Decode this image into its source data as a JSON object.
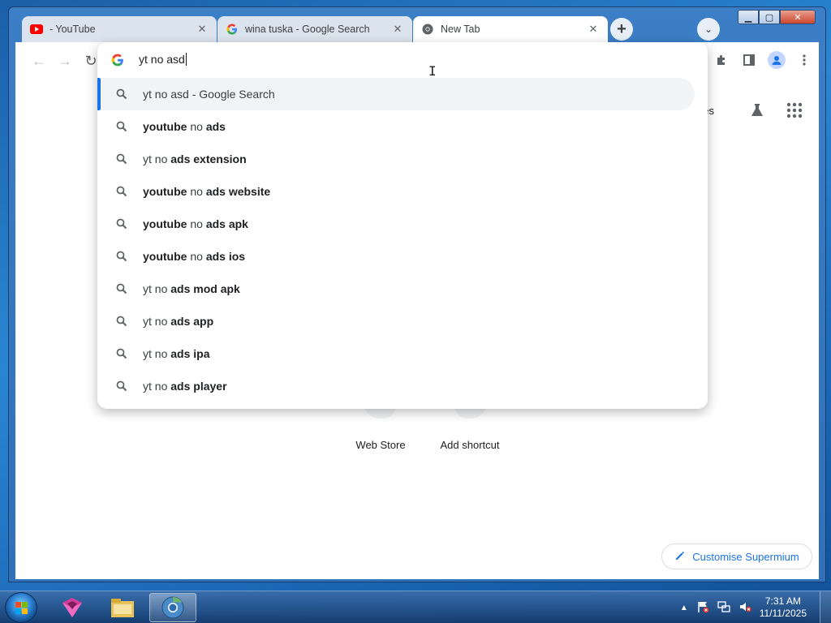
{
  "window": {
    "controls": {
      "minimize": "▁",
      "maximize": "▢",
      "close": "✕"
    }
  },
  "tabs": [
    {
      "title": "- YouTube",
      "icon": "youtube-icon",
      "active": false
    },
    {
      "title": "wina tuska - Google Search",
      "icon": "google-icon",
      "active": false
    },
    {
      "title": "New Tab",
      "icon": "chromium-icon",
      "active": true
    }
  ],
  "toolbar": {
    "icons": [
      "back-icon",
      "forward-icon",
      "reload-icon",
      "extensions-icon",
      "side-panel-icon",
      "profile-icon",
      "menu-icon"
    ]
  },
  "omnibox": {
    "typed_text": "yt no asd",
    "suggestions": [
      {
        "plain": "yt no asd",
        "bold": "",
        "suffix": " - Google Search",
        "selected": true
      },
      {
        "bold1": "youtube",
        "plain": " no ",
        "bold": "ads"
      },
      {
        "bold1": "",
        "plain": "yt no ",
        "bold": "ads extension"
      },
      {
        "bold1": "youtube",
        "plain": " no ",
        "bold": "ads website"
      },
      {
        "bold1": "youtube",
        "plain": " no ",
        "bold": "ads apk"
      },
      {
        "bold1": "youtube",
        "plain": " no ",
        "bold": "ads ios"
      },
      {
        "bold1": "",
        "plain": "yt no ",
        "bold": "ads mod apk"
      },
      {
        "bold1": "",
        "plain": "yt no ",
        "bold": "ads app"
      },
      {
        "bold1": "",
        "plain": "yt no ",
        "bold": "ads ipa"
      },
      {
        "bold1": "",
        "plain": "yt no ",
        "bold": "ads player"
      }
    ]
  },
  "page": {
    "images_link_partial": "ges",
    "shortcuts": [
      {
        "label": "Web Store"
      },
      {
        "label": "Add shortcut"
      }
    ],
    "customise_label": "Customise Supermium"
  },
  "taskbar": {
    "apps": [
      "start-orb",
      "sketch-app-icon",
      "file-explorer-icon",
      "chromium-browser-icon"
    ],
    "tray_icons": [
      "show-hidden-icons-icon",
      "action-center-flag-icon",
      "network-icon",
      "volume-muted-icon"
    ],
    "time": "7:31 AM",
    "date": "11/11/2025"
  },
  "colors": {
    "accent": "#1a73e8",
    "selected_row_bg": "#f1f3f4",
    "taskbar": "#1d4f8c"
  }
}
